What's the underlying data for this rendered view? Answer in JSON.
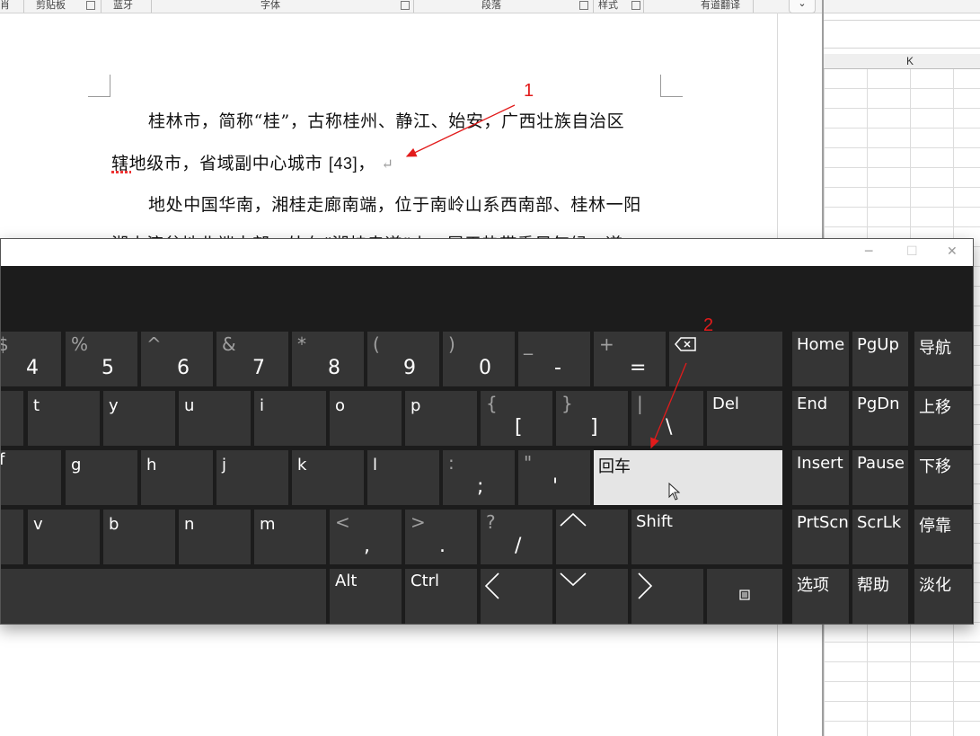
{
  "word": {
    "ribbon_groups": [
      "肖",
      "剪贴板",
      "蓝牙",
      "字体",
      "段落",
      "样式",
      "有道翻译"
    ],
    "collapse_icon": "chevron-down-icon",
    "paragraph1_line1": "桂林市，简称“桂”，古称桂州、静江、始安，广西壮族自治区",
    "paragraph1_line2_prefix": "辖地级市，省域副中心城市",
    "citation": "[43]",
    "comma": "，",
    "paragraph_mark": "↵",
    "paragraph2_line1": "地处中国华南，湘桂走廊南端，位于南岭山系西南部、桂林一阳",
    "paragraph2_line2_partial": "湘山演盆地北端中部，处在“湘桂走道”上，属于热带季风气候，道"
  },
  "excel": {
    "column_header": "K"
  },
  "keyboard": {
    "row1": [
      {
        "alt": "$",
        "main": ""
      },
      {
        "alt": "$",
        "main": "4"
      },
      {
        "alt": "%",
        "main": "5"
      },
      {
        "alt": "^",
        "main": "6"
      },
      {
        "alt": "&",
        "main": "7"
      },
      {
        "alt": "*",
        "main": "8"
      },
      {
        "alt": "(",
        "main": "9"
      },
      {
        "alt": ")",
        "main": "0"
      },
      {
        "alt": "_",
        "main": "-"
      },
      {
        "alt": "+",
        "main": "="
      }
    ],
    "row2": [
      "t",
      "y",
      "u",
      "i",
      "o",
      "p"
    ],
    "row2_sym": [
      {
        "alt": "{",
        "main": "["
      },
      {
        "alt": "}",
        "main": "]"
      },
      {
        "alt": "|",
        "main": "\\"
      }
    ],
    "del": "Del",
    "row3": [
      "f",
      "g",
      "h",
      "j",
      "k",
      "l"
    ],
    "row3_sym": [
      {
        "alt": ":",
        "main": ";"
      },
      {
        "alt": "\"",
        "main": "'"
      }
    ],
    "enter": "回车",
    "row4": [
      "v",
      "b",
      "n",
      "m"
    ],
    "row4_sym": [
      {
        "alt": "<",
        "main": ","
      },
      {
        "alt": ">",
        "main": "."
      },
      {
        "alt": "?",
        "main": "/"
      }
    ],
    "shift": "Shift",
    "alt": "Alt",
    "ctrl": "Ctrl",
    "nav": [
      [
        "Home",
        "PgUp",
        "导航"
      ],
      [
        "End",
        "PgDn",
        "上移"
      ],
      [
        "Insert",
        "Pause",
        "下移"
      ],
      [
        "PrtScn",
        "ScrLk",
        "停靠"
      ],
      [
        "选项",
        "帮助",
        "淡化"
      ]
    ],
    "window_controls": {
      "minimize": "─",
      "maximize": "☐",
      "close": "✕"
    }
  },
  "annotations": {
    "label1": "1",
    "label2": "2",
    "color": "#e21b1b"
  }
}
